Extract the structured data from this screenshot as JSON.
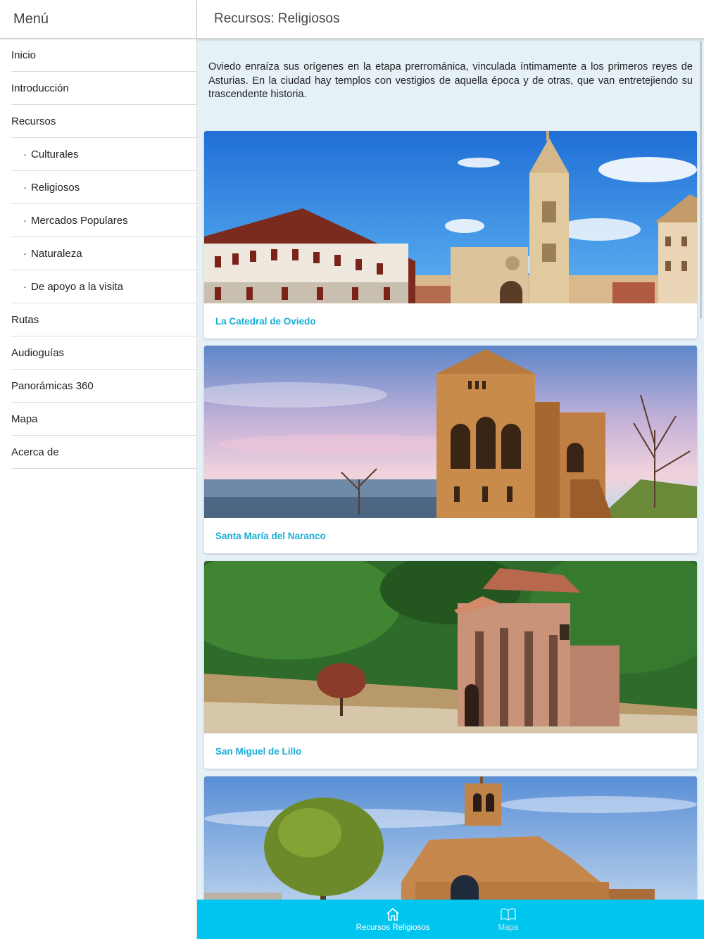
{
  "sidebar": {
    "title": "Menú",
    "items": [
      {
        "label": "Inicio"
      },
      {
        "label": "Introducción"
      },
      {
        "label": "Recursos"
      },
      {
        "label": "Culturales",
        "bullet": "·"
      },
      {
        "label": "Religiosos",
        "bullet": "·"
      },
      {
        "label": "Mercados Populares",
        "bullet": "·"
      },
      {
        "label": "Naturaleza",
        "bullet": "·"
      },
      {
        "label": "De apoyo a la visita",
        "bullet": "·"
      },
      {
        "label": "Rutas"
      },
      {
        "label": "Audioguías"
      },
      {
        "label": "Panorámicas 360"
      },
      {
        "label": "Mapa"
      },
      {
        "label": "Acerca de"
      }
    ]
  },
  "header": {
    "title": "Recursos: Religiosos"
  },
  "main": {
    "intro": "Oviedo enraíza sus orígenes en la etapa prerrománica, vinculada íntimamente a los primeros reyes de Asturias. En la ciudad hay templos con vestigios de aquella época y de otras, que van entretejiendo su trascendente historia.",
    "cards": [
      {
        "title": "La Catedral de Oviedo",
        "image_icon": "cathedral-photo"
      },
      {
        "title": "Santa María del Naranco",
        "image_icon": "naranco-photo"
      },
      {
        "title": "San Miguel de Lillo",
        "image_icon": "lillo-photo"
      },
      {
        "title": "",
        "image_icon": "church-photo"
      }
    ]
  },
  "tabbar": {
    "tabs": [
      {
        "label": "Recursos Religiosos",
        "icon": "home-icon",
        "active": true
      },
      {
        "label": "Mapa",
        "icon": "map-book-icon",
        "active": false
      }
    ]
  },
  "colors": {
    "accent": "#00c5ee",
    "card_title": "#1aaed6",
    "content_bg": "#e5f1f7"
  }
}
